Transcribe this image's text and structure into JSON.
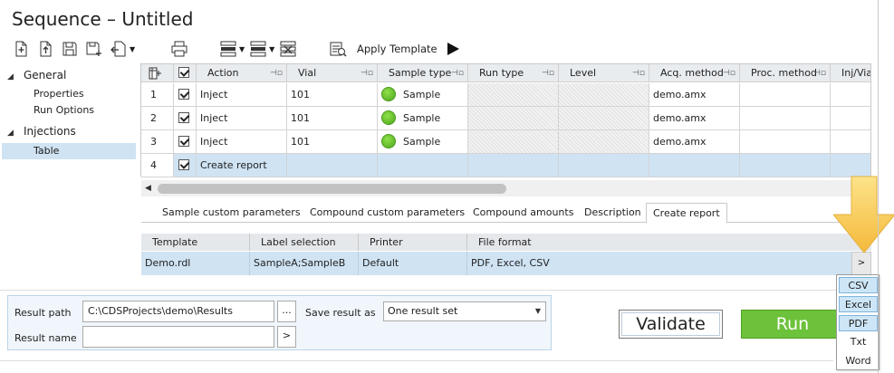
{
  "window": {
    "title": "Sequence – Untitled"
  },
  "toolbar": {
    "icons": [
      "new-icon",
      "import-icon",
      "save-icon",
      "save-as-icon",
      "undo-icon",
      "print-icon",
      "insert-row-icon",
      "insert-row-after-icon",
      "delete-row-icon",
      "apply-template-icon",
      "run-icon"
    ],
    "apply_template_label": "Apply Template"
  },
  "nav": {
    "groups": [
      {
        "label": "General",
        "items": [
          "Properties",
          "Run Options"
        ]
      },
      {
        "label": "Injections",
        "items": [
          "Table"
        ]
      }
    ],
    "selected": "Table"
  },
  "grid": {
    "columns": [
      "Action",
      "Vial",
      "Sample type",
      "Run type",
      "Level",
      "Acq. method",
      "Proc. method",
      "Inj/Via"
    ],
    "rows": [
      {
        "num": "1",
        "checked": true,
        "action": "Inject",
        "vial": "101",
        "sample_type": "Sample",
        "acq": "demo.amx"
      },
      {
        "num": "2",
        "checked": true,
        "action": "Inject",
        "vial": "101",
        "sample_type": "Sample",
        "acq": "demo.amx"
      },
      {
        "num": "3",
        "checked": true,
        "action": "Inject",
        "vial": "101",
        "sample_type": "Sample",
        "acq": "demo.amx"
      },
      {
        "num": "4",
        "checked": true,
        "action": "Create report",
        "vial": "",
        "sample_type": "",
        "acq": ""
      }
    ]
  },
  "tabs": [
    "Sample custom parameters",
    "Compound custom parameters",
    "Compound amounts",
    "Description",
    "Create report"
  ],
  "active_tab": "Create report",
  "report": {
    "columns": [
      "Template",
      "Label selection",
      "Printer",
      "File format"
    ],
    "row": {
      "template": "Demo.rdl",
      "label_selection": "SampleA;SampleB",
      "printer": "Default",
      "file_format": "PDF, Excel, CSV"
    },
    "expand_label": ">"
  },
  "format_menu": {
    "items": [
      "CSV",
      "Excel",
      "PDF",
      "Txt",
      "Word"
    ],
    "selected": [
      "CSV",
      "Excel",
      "PDF"
    ]
  },
  "result": {
    "path_label": "Result path",
    "path_value": "C:\\CDSProjects\\demo\\Results",
    "browse_label": "...",
    "name_label": "Result name",
    "name_value": "",
    "name_btn_label": ">",
    "save_label": "Save result as",
    "save_value": "One result set"
  },
  "actions": {
    "validate": "Validate",
    "run": "Run"
  },
  "colors": {
    "selection": "#cfe3f3",
    "run_green": "#6cc23a",
    "sample_dot": "#5cb82a",
    "arrow": "#f7c948"
  }
}
